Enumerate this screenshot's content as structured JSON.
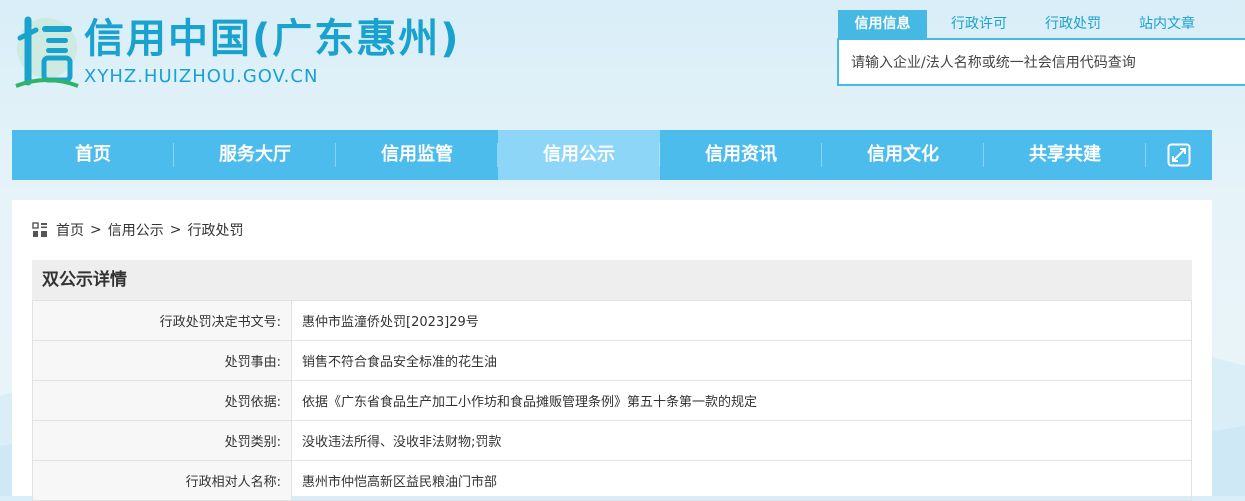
{
  "header": {
    "title": "信用中国(广东惠州)",
    "url": "XYHZ.HUIZHOU.GOV.CN",
    "brand_color": "#1aa2cf"
  },
  "search": {
    "tabs": [
      {
        "label": "信用信息",
        "active": true
      },
      {
        "label": "行政许可",
        "active": false
      },
      {
        "label": "行政处罚",
        "active": false
      },
      {
        "label": "站内文章",
        "active": false
      }
    ],
    "placeholder": "请输入企业/法人名称或统一社会信用代码查询"
  },
  "nav": {
    "items": [
      {
        "label": "首页"
      },
      {
        "label": "服务大厅"
      },
      {
        "label": "信用监管"
      },
      {
        "label": "信用公示",
        "active": true
      },
      {
        "label": "信用资讯"
      },
      {
        "label": "信用文化"
      },
      {
        "label": "共享共建"
      }
    ],
    "expand_icon": "expand-icon",
    "color": "#4cbcec",
    "active_color": "#8ed6f7"
  },
  "breadcrumb": {
    "icon": "grid-icon",
    "items": [
      "首页",
      "信用公示",
      "行政处罚"
    ],
    "separator": ">"
  },
  "detail": {
    "title": "双公示详情",
    "rows": [
      {
        "label": "行政处罚决定书文号:",
        "value": "惠仲市监潼侨处罚[2023]29号"
      },
      {
        "label": "处罚事由:",
        "value": "销售不符合食品安全标准的花生油"
      },
      {
        "label": "处罚依据:",
        "value": "依据《广东省食品生产加工小作坊和食品摊贩管理条例》第五十条第一款的规定"
      },
      {
        "label": "处罚类别:",
        "value": "没收违法所得、没收非法财物;罚款"
      },
      {
        "label": "行政相对人名称:",
        "value": "惠州市仲恺高新区益民粮油门市部"
      }
    ]
  }
}
